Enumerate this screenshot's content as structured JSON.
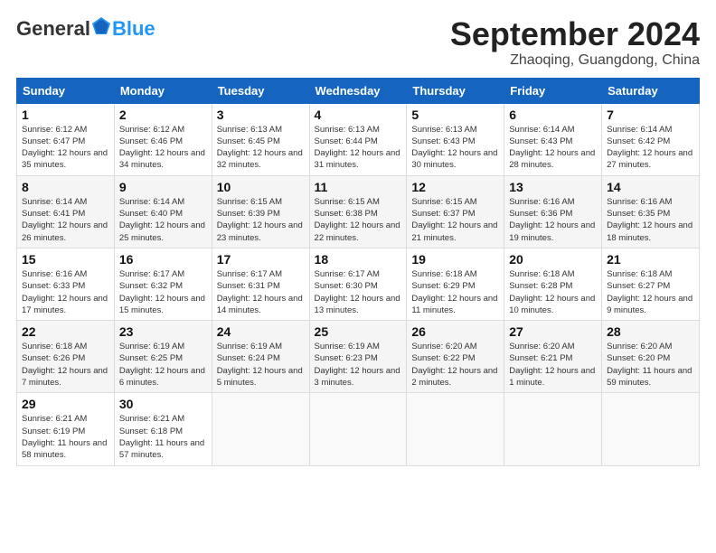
{
  "logo": {
    "general": "General",
    "blue": "Blue"
  },
  "header": {
    "month": "September 2024",
    "location": "Zhaoqing, Guangdong, China"
  },
  "weekdays": [
    "Sunday",
    "Monday",
    "Tuesday",
    "Wednesday",
    "Thursday",
    "Friday",
    "Saturday"
  ],
  "weeks": [
    [
      {
        "day": "1",
        "sunrise": "6:12 AM",
        "sunset": "6:47 PM",
        "daylight": "12 hours and 35 minutes."
      },
      {
        "day": "2",
        "sunrise": "6:12 AM",
        "sunset": "6:46 PM",
        "daylight": "12 hours and 34 minutes."
      },
      {
        "day": "3",
        "sunrise": "6:13 AM",
        "sunset": "6:45 PM",
        "daylight": "12 hours and 32 minutes."
      },
      {
        "day": "4",
        "sunrise": "6:13 AM",
        "sunset": "6:44 PM",
        "daylight": "12 hours and 31 minutes."
      },
      {
        "day": "5",
        "sunrise": "6:13 AM",
        "sunset": "6:43 PM",
        "daylight": "12 hours and 30 minutes."
      },
      {
        "day": "6",
        "sunrise": "6:14 AM",
        "sunset": "6:43 PM",
        "daylight": "12 hours and 28 minutes."
      },
      {
        "day": "7",
        "sunrise": "6:14 AM",
        "sunset": "6:42 PM",
        "daylight": "12 hours and 27 minutes."
      }
    ],
    [
      {
        "day": "8",
        "sunrise": "6:14 AM",
        "sunset": "6:41 PM",
        "daylight": "12 hours and 26 minutes."
      },
      {
        "day": "9",
        "sunrise": "6:14 AM",
        "sunset": "6:40 PM",
        "daylight": "12 hours and 25 minutes."
      },
      {
        "day": "10",
        "sunrise": "6:15 AM",
        "sunset": "6:39 PM",
        "daylight": "12 hours and 23 minutes."
      },
      {
        "day": "11",
        "sunrise": "6:15 AM",
        "sunset": "6:38 PM",
        "daylight": "12 hours and 22 minutes."
      },
      {
        "day": "12",
        "sunrise": "6:15 AM",
        "sunset": "6:37 PM",
        "daylight": "12 hours and 21 minutes."
      },
      {
        "day": "13",
        "sunrise": "6:16 AM",
        "sunset": "6:36 PM",
        "daylight": "12 hours and 19 minutes."
      },
      {
        "day": "14",
        "sunrise": "6:16 AM",
        "sunset": "6:35 PM",
        "daylight": "12 hours and 18 minutes."
      }
    ],
    [
      {
        "day": "15",
        "sunrise": "6:16 AM",
        "sunset": "6:33 PM",
        "daylight": "12 hours and 17 minutes."
      },
      {
        "day": "16",
        "sunrise": "6:17 AM",
        "sunset": "6:32 PM",
        "daylight": "12 hours and 15 minutes."
      },
      {
        "day": "17",
        "sunrise": "6:17 AM",
        "sunset": "6:31 PM",
        "daylight": "12 hours and 14 minutes."
      },
      {
        "day": "18",
        "sunrise": "6:17 AM",
        "sunset": "6:30 PM",
        "daylight": "12 hours and 13 minutes."
      },
      {
        "day": "19",
        "sunrise": "6:18 AM",
        "sunset": "6:29 PM",
        "daylight": "12 hours and 11 minutes."
      },
      {
        "day": "20",
        "sunrise": "6:18 AM",
        "sunset": "6:28 PM",
        "daylight": "12 hours and 10 minutes."
      },
      {
        "day": "21",
        "sunrise": "6:18 AM",
        "sunset": "6:27 PM",
        "daylight": "12 hours and 9 minutes."
      }
    ],
    [
      {
        "day": "22",
        "sunrise": "6:18 AM",
        "sunset": "6:26 PM",
        "daylight": "12 hours and 7 minutes."
      },
      {
        "day": "23",
        "sunrise": "6:19 AM",
        "sunset": "6:25 PM",
        "daylight": "12 hours and 6 minutes."
      },
      {
        "day": "24",
        "sunrise": "6:19 AM",
        "sunset": "6:24 PM",
        "daylight": "12 hours and 5 minutes."
      },
      {
        "day": "25",
        "sunrise": "6:19 AM",
        "sunset": "6:23 PM",
        "daylight": "12 hours and 3 minutes."
      },
      {
        "day": "26",
        "sunrise": "6:20 AM",
        "sunset": "6:22 PM",
        "daylight": "12 hours and 2 minutes."
      },
      {
        "day": "27",
        "sunrise": "6:20 AM",
        "sunset": "6:21 PM",
        "daylight": "12 hours and 1 minute."
      },
      {
        "day": "28",
        "sunrise": "6:20 AM",
        "sunset": "6:20 PM",
        "daylight": "11 hours and 59 minutes."
      }
    ],
    [
      {
        "day": "29",
        "sunrise": "6:21 AM",
        "sunset": "6:19 PM",
        "daylight": "11 hours and 58 minutes."
      },
      {
        "day": "30",
        "sunrise": "6:21 AM",
        "sunset": "6:18 PM",
        "daylight": "11 hours and 57 minutes."
      },
      null,
      null,
      null,
      null,
      null
    ]
  ]
}
